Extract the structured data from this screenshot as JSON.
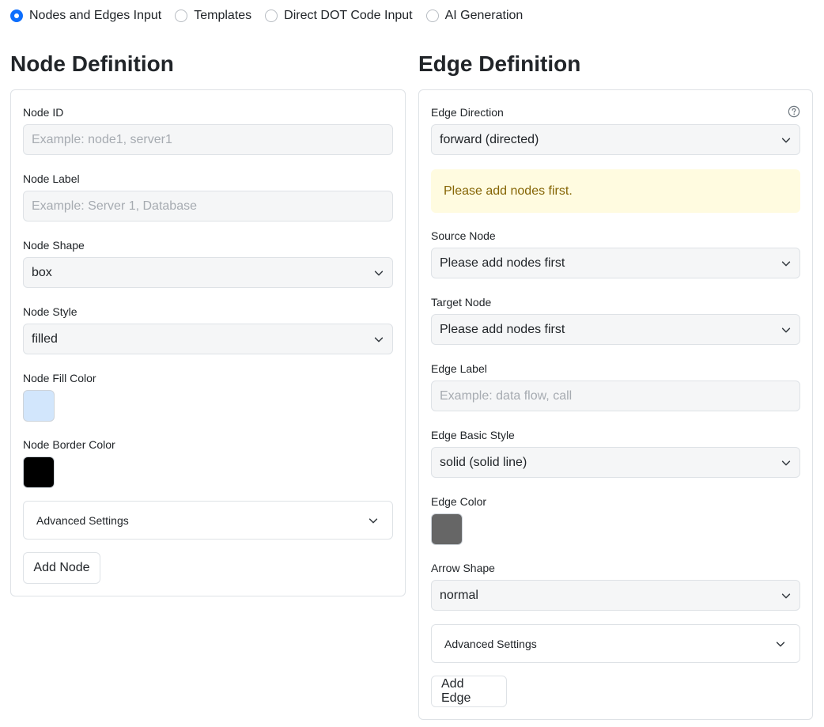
{
  "modes": [
    {
      "label": "Nodes and Edges Input",
      "checked": true
    },
    {
      "label": "Templates",
      "checked": false
    },
    {
      "label": "Direct DOT Code Input",
      "checked": false
    },
    {
      "label": "AI Generation",
      "checked": false
    }
  ],
  "node": {
    "title": "Node Definition",
    "id_label": "Node ID",
    "id_placeholder": "Example: node1, server1",
    "label_label": "Node Label",
    "label_placeholder": "Example: Server 1, Database",
    "shape_label": "Node Shape",
    "shape_value": "box",
    "style_label": "Node Style",
    "style_value": "filled",
    "fill_label": "Node Fill Color",
    "fill_color": "#d2e6fc",
    "border_label": "Node Border Color",
    "border_color": "#000000",
    "advanced_label": "Advanced Settings",
    "add_button": "Add Node"
  },
  "edge": {
    "title": "Edge Definition",
    "direction_label": "Edge Direction",
    "direction_value": "forward (directed)",
    "alert": "Please add nodes first.",
    "source_label": "Source Node",
    "source_value": "Please add nodes first",
    "target_label": "Target Node",
    "target_value": "Please add nodes first",
    "label_label": "Edge Label",
    "label_placeholder": "Example: data flow, call",
    "style_label": "Edge Basic Style",
    "style_value": "solid (solid line)",
    "color_label": "Edge Color",
    "edge_color": "#666666",
    "arrow_label": "Arrow Shape",
    "arrow_value": "normal",
    "advanced_label": "Advanced Settings",
    "add_button": "Add Edge"
  },
  "icons": {
    "chevron": "chevron-down-icon",
    "help": "question-circle-icon"
  },
  "colors": {
    "accent": "#0d6efd",
    "alert_bg": "#fffbe0",
    "alert_text": "#856404"
  }
}
